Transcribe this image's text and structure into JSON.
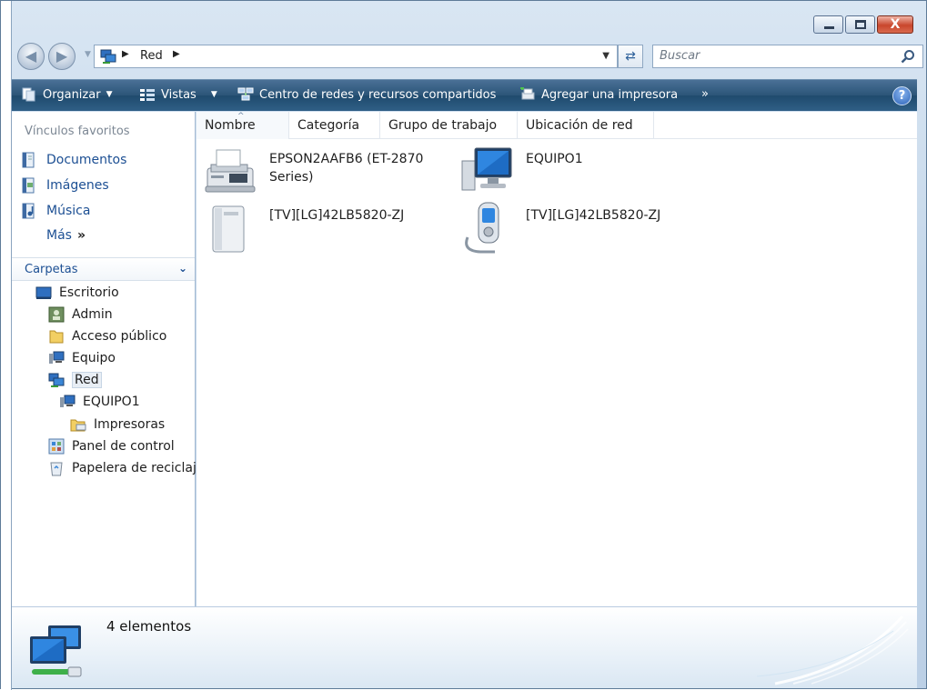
{
  "window": {
    "buttons": {
      "minimize": "minimize",
      "maximize": "maximize",
      "close": "X"
    }
  },
  "navigation": {
    "back_glyph": "◀",
    "forward_glyph": "▶",
    "address_path": "Red",
    "search_placeholder": "Buscar",
    "refresh_glyph": "⇄"
  },
  "toolbar": {
    "organize_label": "Organizar",
    "views_label": "Vistas",
    "network_center_label": "Centro de redes y recursos compartidos",
    "add_printer_label": "Agregar una impresora",
    "overflow_label": "»",
    "help_label": "?"
  },
  "sidebar": {
    "favorites_header": "Vínculos favoritos",
    "favorites": [
      {
        "label": "Documentos",
        "icon": "documents-icon"
      },
      {
        "label": "Imágenes",
        "icon": "pictures-icon"
      },
      {
        "label": "Música",
        "icon": "music-icon"
      }
    ],
    "more_label": "Más",
    "more_glyph": "»",
    "folders_label": "Carpetas",
    "folders_glyph": "⌄",
    "tree": [
      {
        "label": "Escritorio",
        "icon": "desktop-icon"
      },
      {
        "label": "Admin",
        "icon": "user-folder-icon"
      },
      {
        "label": "Acceso público",
        "icon": "folder-icon"
      },
      {
        "label": "Equipo",
        "icon": "computer-icon"
      },
      {
        "label": "Red",
        "icon": "network-icon",
        "selected": true
      },
      {
        "label": "EQUIPO1",
        "icon": "computer-icon"
      },
      {
        "label": "Impresoras",
        "icon": "printer-folder-icon"
      },
      {
        "label": "Panel de control",
        "icon": "control-panel-icon"
      },
      {
        "label": "Papelera de reciclaje",
        "icon": "recycle-bin-icon"
      }
    ]
  },
  "columns": [
    "Nombre",
    "Categoría",
    "Grupo de trabajo",
    "Ubicación de red"
  ],
  "sort_glyph": "^",
  "items": [
    {
      "name": "EPSON2AAFB6 (ET-2870 Series)",
      "icon": "fax-printer-icon"
    },
    {
      "name": "EQUIPO1",
      "icon": "computer-monitor-icon"
    },
    {
      "name": "[TV][LG]42LB5820-ZJ",
      "icon": "media-device-icon"
    },
    {
      "name": "[TV][LG]42LB5820-ZJ",
      "icon": "mobile-device-icon"
    }
  ],
  "details": {
    "count_text": "4 elementos",
    "icon": "network-computers-icon"
  },
  "colors": {
    "toolbar": "#2b5578",
    "link": "#1c4f93",
    "frame": "#c6d8ea"
  }
}
